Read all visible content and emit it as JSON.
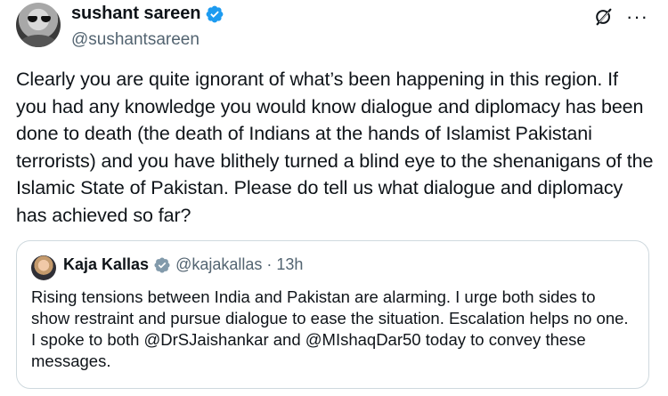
{
  "post": {
    "author": {
      "display_name": "sushant sareen",
      "handle": "@sushantsareen",
      "verified": true,
      "avatar_icon": "profile-photo-sunglasses"
    },
    "text": "Clearly you are quite ignorant of what’s been happening in this region. If you had any knowledge you would know dialogue and diplomacy has been done to death (the death of Indians at the hands of Islamist Pakistani terrorists) and you have blithely turned a blind eye to the shenanigans of the Islamic State of Pakistan. Please do tell us what dialogue and diplomacy has achieved so far?",
    "actions": {
      "grok_icon": "grok-icon",
      "more_label": "···"
    }
  },
  "quote": {
    "author": {
      "display_name": "Kaja Kallas",
      "handle": "@kajakallas",
      "separator": "·",
      "time": "13h",
      "verified": true,
      "avatar_icon": "profile-photo-woman"
    },
    "text": "Rising tensions between India and Pakistan are alarming. I urge both sides to show restraint and pursue dialogue to ease the situation. Escalation helps no one. I spoke to both @DrSJaishankar and @MIshaqDar50 today to convey these messages."
  },
  "colors": {
    "primary_text": "#0f1419",
    "secondary_text": "#536471",
    "verified_blue": "#1d9bf0",
    "card_border": "#cfd9de"
  }
}
